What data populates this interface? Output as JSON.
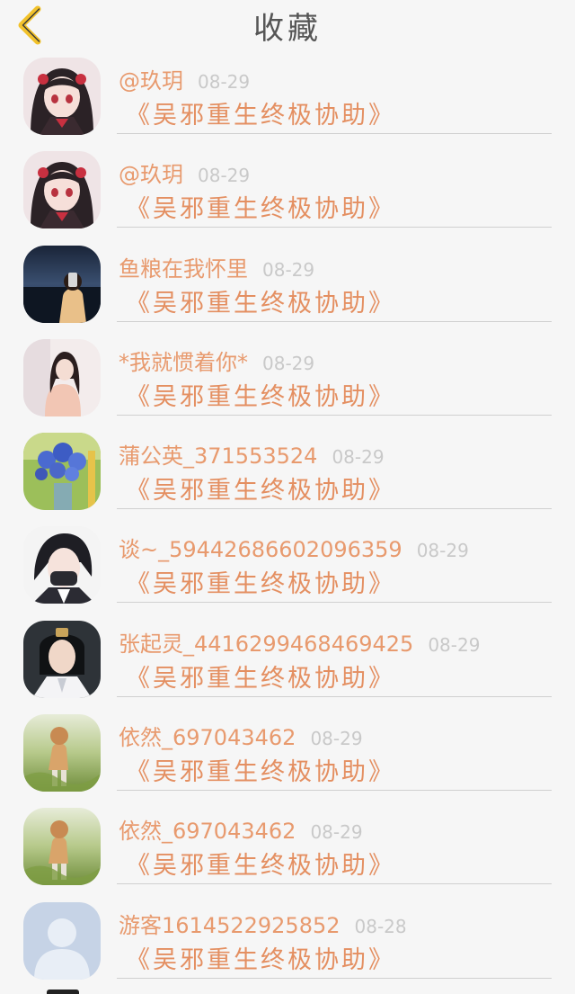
{
  "header": {
    "title": "收藏"
  },
  "favorites": [
    {
      "name": "@玖玥",
      "date": "08-29",
      "book": "《吴邪重生终极协助》",
      "avatar": "anime-girl-dark-hair-icon"
    },
    {
      "name": "@玖玥",
      "date": "08-29",
      "book": "《吴邪重生终极协助》",
      "avatar": "anime-girl-dark-hair-icon"
    },
    {
      "name": "鱼粮在我怀里",
      "date": "08-29",
      "book": "《吴邪重生终极协助》",
      "avatar": "girl-night-sea-photo"
    },
    {
      "name": "*我就惯着你*",
      "date": "08-29",
      "book": "《吴邪重生终极协助》",
      "avatar": "girl-pink-sweater-photo"
    },
    {
      "name": "蒲公英_371553524",
      "date": "08-29",
      "book": "《吴邪重生终极协助》",
      "avatar": "blue-flowers-vase-photo"
    },
    {
      "name": "谈~_59442686602096359",
      "date": "08-29",
      "book": "《吴邪重生终极协助》",
      "avatar": "anime-boy-mask-icon"
    },
    {
      "name": "张起灵_4416299468469425",
      "date": "08-29",
      "book": "《吴邪重生终极协助》",
      "avatar": "costume-man-white-robe-photo"
    },
    {
      "name": "依然_697043462",
      "date": "08-29",
      "book": "《吴邪重生终极协助》",
      "avatar": "girl-grass-field-photo"
    },
    {
      "name": "依然_697043462",
      "date": "08-29",
      "book": "《吴邪重生终极协助》",
      "avatar": "girl-grass-field-photo"
    },
    {
      "name": "游客1614522925852",
      "date": "08-28",
      "book": "《吴邪重生终极协助》",
      "avatar": "default-user-icon"
    }
  ],
  "colors": {
    "background": "#f6f6f6",
    "back_arrow": "#f2c22b",
    "name": "#e89a6e",
    "book": "#e48f61",
    "date": "#c9c9c9",
    "divider": "#d0d0d0"
  }
}
